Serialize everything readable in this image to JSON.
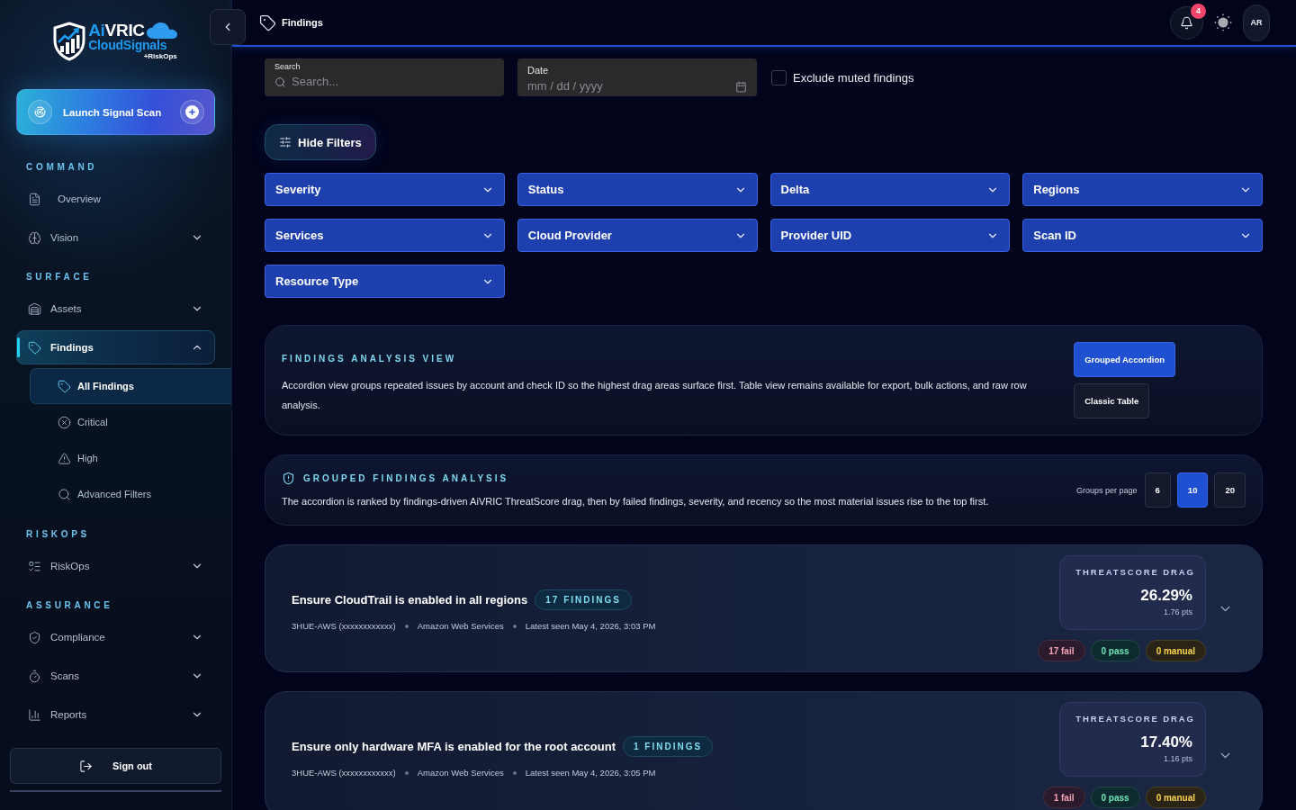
{
  "sidebar": {
    "logo": {
      "name_accent": "Ai",
      "name_rest": "VRIC",
      "product": "CloudSignals",
      "tagline": "+RiskOps"
    },
    "launch_button": {
      "label": "Launch Signal Scan"
    },
    "sections": [
      {
        "title": "COMMAND",
        "items": [
          {
            "label": "Overview",
            "selected": false
          },
          {
            "label": "Vision",
            "selected": false,
            "expanded": false
          }
        ]
      },
      {
        "title": "SURFACE",
        "items": [
          {
            "label": "Assets",
            "selected": false,
            "expanded": false
          },
          {
            "label": "Findings",
            "selected": true,
            "expanded": true,
            "children": [
              {
                "label": "All Findings",
                "selected": true
              },
              {
                "label": "Critical",
                "selected": false
              },
              {
                "label": "High",
                "selected": false
              },
              {
                "label": "Advanced Filters",
                "selected": false
              }
            ]
          }
        ]
      },
      {
        "title": "RISKOPS",
        "items": [
          {
            "label": "RiskOps",
            "selected": false,
            "expanded": false
          }
        ]
      },
      {
        "title": "ASSURANCE",
        "items": [
          {
            "label": "Compliance",
            "selected": false,
            "expanded": false
          },
          {
            "label": "Scans",
            "selected": false,
            "expanded": false
          },
          {
            "label": "Reports",
            "selected": false,
            "expanded": false
          }
        ]
      }
    ],
    "sign_out": {
      "label": "Sign out"
    }
  },
  "topbar": {
    "title": "Findings",
    "notifications": {
      "count": "4"
    },
    "avatar": {
      "initials": "AR"
    }
  },
  "filters": {
    "search": {
      "label": "Search",
      "placeholder": "Search..."
    },
    "date": {
      "label": "Date",
      "placeholder": "mm / dd / yyyy"
    },
    "exclude_muted": {
      "label": "Exclude muted findings",
      "checked": false
    },
    "toggle_button": {
      "label": "Hide Filters"
    },
    "dropdowns": [
      {
        "label": "Severity"
      },
      {
        "label": "Status"
      },
      {
        "label": "Delta"
      },
      {
        "label": "Regions"
      },
      {
        "label": "Services"
      },
      {
        "label": "Cloud Provider"
      },
      {
        "label": "Provider UID"
      },
      {
        "label": "Scan ID"
      },
      {
        "label": "Resource Type"
      }
    ]
  },
  "analysis_view": {
    "title": "FINDINGS ANALYSIS VIEW",
    "description": "Accordion view groups repeated issues by account and check ID so the highest drag areas surface first. Table view remains available for export, bulk actions, and raw row analysis.",
    "views": [
      {
        "label": "Grouped Accordion",
        "selected": true
      },
      {
        "label": "Classic Table",
        "selected": false
      }
    ]
  },
  "grouped_analysis": {
    "title": "GROUPED FINDINGS ANALYSIS",
    "description": "The accordion is ranked by findings-driven AiVRIC ThreatScore drag, then by failed findings, severity, and recency so the most material issues rise to the top first.",
    "page_size_label": "Groups per page",
    "page_sizes": [
      {
        "label": "6",
        "selected": false
      },
      {
        "label": "10",
        "selected": true
      },
      {
        "label": "20",
        "selected": false
      }
    ]
  },
  "finding_groups": [
    {
      "title": "Ensure CloudTrail is enabled in all regions",
      "count": "17 FINDINGS",
      "account": "3HUE-AWS (xxxxxxxxxxxx)",
      "provider": "Amazon Web Services",
      "last_seen": "Latest seen May 4, 2026, 3:03 PM",
      "score_label": "THREATSCORE DRAG",
      "score": "26.29%",
      "points": "1.76 pts",
      "expanded": false,
      "results": [
        {
          "kind": "fail",
          "label": "17 fail"
        },
        {
          "kind": "pass",
          "label": "0 pass"
        },
        {
          "kind": "manual",
          "label": "0 manual"
        }
      ]
    },
    {
      "title": "Ensure only hardware MFA is enabled for the root account",
      "count": "1 FINDINGS",
      "account": "3HUE-AWS (xxxxxxxxxxxx)",
      "provider": "Amazon Web Services",
      "last_seen": "Latest seen May 4, 2026, 3:05 PM",
      "score_label": "THREATSCORE DRAG",
      "score": "17.40%",
      "points": "1.16 pts",
      "expanded": false,
      "results": [
        {
          "kind": "fail",
          "label": "1 fail"
        },
        {
          "kind": "pass",
          "label": "0 pass"
        },
        {
          "kind": "manual",
          "label": "0 manual"
        }
      ]
    }
  ]
}
